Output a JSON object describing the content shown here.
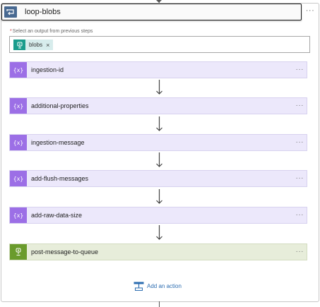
{
  "loop": {
    "title": "loop-blobs",
    "more": "···",
    "field_label": "Select an output from previous steps",
    "required_marker": "*",
    "token": {
      "label": "blobs",
      "remove": "×"
    }
  },
  "actions": [
    {
      "label": "ingestion-id",
      "icon": "variable-icon",
      "icon_text": "{x}",
      "more": "···"
    },
    {
      "label": "additional-properties",
      "icon": "variable-icon",
      "icon_text": "{x}",
      "more": "···"
    },
    {
      "label": "ingestion-message",
      "icon": "variable-icon",
      "icon_text": "{x}",
      "more": "···"
    },
    {
      "label": "add-flush-messages",
      "icon": "variable-icon",
      "icon_text": "{x}",
      "more": "···"
    },
    {
      "label": "add-raw-data-size",
      "icon": "variable-icon",
      "icon_text": "{x}",
      "more": "···"
    },
    {
      "label": "post-message-to-queue",
      "icon": "storage-queue-icon",
      "icon_text": "",
      "more": "···"
    }
  ],
  "add_action": {
    "label": "Add an action"
  },
  "colors": {
    "variable_card": "#ece8fb",
    "variable_icon": "#9c6fe6",
    "queue_card": "#e7edda",
    "queue_icon": "#6a9b2c",
    "loop_icon": "#486991",
    "token_icon": "#1a9c8c",
    "link": "#2b6cb0"
  }
}
